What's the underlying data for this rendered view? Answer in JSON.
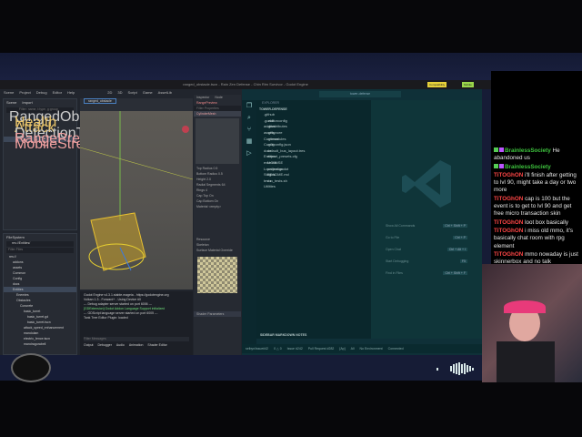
{
  "window_title": "ranged_obstacle.tscn - Rain Zen Defense - Chin Rim Survivor - Godot Engine",
  "title_tags": [
    "Compatibility",
    "Mobile"
  ],
  "godot": {
    "menu": [
      "Scene",
      "Project",
      "Debug",
      "Editor",
      "Help"
    ],
    "workspaces": [
      "2D",
      "3D",
      "Script",
      "Game",
      "AssetLib"
    ],
    "scene_tabs": [
      "Scene",
      "Import"
    ],
    "filter_placeholder": "Filter: name, t:type, g:group",
    "scene_tree": [
      "RangedObstacle",
      "Health",
      "Attack",
      "DetectionTimer",
      "RangePreview",
      "MobileStreamPlayer3D"
    ],
    "open_tab": "ranged_obstacle",
    "filesystem_title": "FileSystem",
    "path": "res://Entities/",
    "filter_files": "Filter Files",
    "files": [
      "res://",
      "addons",
      "assets",
      "Common",
      "Config",
      "docs",
      "Entities",
      "Enemies",
      "Obstacles",
      "Concrete",
      "basic_turret",
      "basic_turret.gd",
      "basic_turret.tscn",
      "attack_speed_enhancement",
      "mandolam",
      "electric_fence.tscn",
      "mandragorabell"
    ],
    "inspector_tabs": [
      "Inspector",
      "Node"
    ],
    "inspector_node": "RangePreview",
    "filter_props": "Filter Properties",
    "resource": "CylinderMesh",
    "props": [
      [
        "Top Radius",
        "0.5"
      ],
      [
        "Bottom Radius",
        "0.5"
      ],
      [
        "Height",
        "2.0"
      ],
      [
        "Radial Segments",
        "64"
      ],
      [
        "Rings",
        "4"
      ],
      [
        "Cap Top",
        "On"
      ],
      [
        "Cap Bottom",
        "On"
      ],
      [
        "Material",
        "<empty>"
      ]
    ],
    "sections": [
      "Resource",
      "Skeleton",
      "Surface Material Override",
      "Shader Parameters"
    ],
    "output": [
      "Godot Engine v4.3.1.stable.mageia - https://godotengine.org",
      "Vulkan 1.3 - Forward+ - Using Device #0",
      "--- Debug adapter server started on port 6006 ---",
      "[GDExtension] Godot Addon Language Support initialized",
      "--- GDScript language server started on port 6005 ---",
      "Tank Tree Editor Plugin: loaded"
    ],
    "filter_messages": "Filter Messages",
    "bottom_tabs": [
      "Output",
      "Debugger",
      "Audio",
      "Animation",
      "Shader Editor"
    ],
    "version": "4.3.stable"
  },
  "vscode": {
    "search": "tower-defense",
    "explorer": "EXPLORER",
    "root": "TOWER-DEFENSE",
    "folders": [
      ".github",
      ".godot",
      "addons",
      "assets",
      "Common",
      "Config",
      "docs",
      "Entities",
      "external",
      "Localization",
      "Stages",
      "tests",
      "Utilities"
    ],
    "files": [
      ".editorconfig",
      ".gitattributes",
      ".gitignore",
      ".gitmodules",
      ".gutconfig.json",
      "default_bus_layout.tres",
      "export_presets.cfg",
      "LICENSE",
      "project.godot",
      "README.md",
      "run_tests.sh"
    ],
    "outline": "SIDEBAR MARKDOWN NOTES",
    "shortcuts": [
      [
        "Show All Commands",
        "Ctrl + Shift + P"
      ],
      [
        "Go to File",
        "Ctrl + P"
      ],
      [
        "Open Chat",
        "Ctrl + Alt + I"
      ],
      [
        "Start Debugging",
        "F5"
      ],
      [
        "Find in Files",
        "Ctrl + Shift + F"
      ]
    ],
    "status": [
      "selbyn/issue#42",
      "0 △ 0",
      "Issue #242",
      "Pull Request #282",
      "[Ap]",
      "All",
      "No Environment",
      "Connected"
    ]
  },
  "chat": [
    {
      "user": "BrainlessSociety",
      "color": "#3ec43e",
      "text": "He abandoned us"
    },
    {
      "user": "BrainlessSociety",
      "color": "#3ec43e",
      "text": ""
    },
    {
      "user": "TiTOGhON",
      "color": "#ff4646",
      "text": "i'll finish after getting to lvl 90, might take a day or two more"
    },
    {
      "user": "TiTOGhON",
      "color": "#ff4646",
      "text": "cap is 100 but the event is to get to lvl 90 and get free micro transaction skin"
    },
    {
      "user": "TiTOGhON",
      "color": "#ff4646",
      "text": "loot box basically"
    },
    {
      "user": "TiTOGhON",
      "color": "#ff4646",
      "text": "i miss old mmo, it's basically chat room with rpg element"
    },
    {
      "user": "TiTOGhON",
      "color": "#ff4646",
      "text": "mmo nowaday is just skinnerbox and no talk"
    }
  ]
}
